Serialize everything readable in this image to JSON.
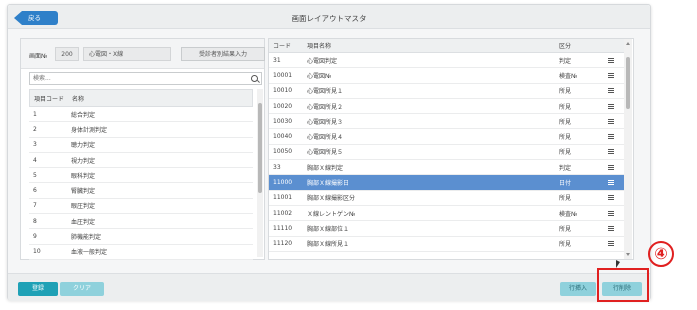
{
  "header": {
    "back_label": "戻る",
    "title": "画面レイアウトマスタ"
  },
  "left_panel": {
    "screen_label": "画面№",
    "screen_code": "200",
    "screen_name": "心電図・X線",
    "action_button": "受診者別結果入力",
    "search_placeholder": "検索...",
    "columns": [
      "項目コード",
      "名称"
    ],
    "rows": [
      {
        "code": "1",
        "name": "総合判定"
      },
      {
        "code": "2",
        "name": "身体計測判定"
      },
      {
        "code": "3",
        "name": "聴力判定"
      },
      {
        "code": "4",
        "name": "視力判定"
      },
      {
        "code": "5",
        "name": "眼科判定"
      },
      {
        "code": "6",
        "name": "腎臓判定"
      },
      {
        "code": "7",
        "name": "眼圧判定"
      },
      {
        "code": "8",
        "name": "血圧判定"
      },
      {
        "code": "9",
        "name": "肺機能判定"
      },
      {
        "code": "10",
        "name": "血液一般判定"
      }
    ]
  },
  "right_panel": {
    "columns": [
      "コード",
      "項目名称",
      "区分"
    ],
    "rows": [
      {
        "code": "31",
        "name": "心電図判定",
        "category": "判定"
      },
      {
        "code": "10001",
        "name": "心電図№",
        "category": "検査№"
      },
      {
        "code": "10010",
        "name": "心電図所見１",
        "category": "所見"
      },
      {
        "code": "10020",
        "name": "心電図所見２",
        "category": "所見"
      },
      {
        "code": "10030",
        "name": "心電図所見３",
        "category": "所見"
      },
      {
        "code": "10040",
        "name": "心電図所見４",
        "category": "所見"
      },
      {
        "code": "10050",
        "name": "心電図所見５",
        "category": "所見"
      },
      {
        "code": "33",
        "name": "胸部Ｘ線判定",
        "category": "判定"
      },
      {
        "code": "11000",
        "name": "胸部Ｘ線撮影日",
        "category": "日付",
        "selected": true
      },
      {
        "code": "11001",
        "name": "胸部Ｘ線撮影区分",
        "category": "所見"
      },
      {
        "code": "11002",
        "name": "Ｘ線レントゲン№",
        "category": "検査№"
      },
      {
        "code": "11110",
        "name": "胸部Ｘ線部位１",
        "category": "所見"
      },
      {
        "code": "11120",
        "name": "胸部Ｘ線所見１",
        "category": "所見"
      }
    ]
  },
  "footer": {
    "register_label": "登録",
    "clear_label": "クリア",
    "insert_row_label": "行挿入",
    "delete_row_label": "行削除"
  },
  "annotation": {
    "step_number": "④",
    "highlight_color": "#e02020"
  },
  "colors": {
    "accent_blue": "#2f80c9",
    "selected_row": "#5b8fd0",
    "teal_button": "#1fa1b6",
    "light_teal_button": "#8fd1dc"
  }
}
